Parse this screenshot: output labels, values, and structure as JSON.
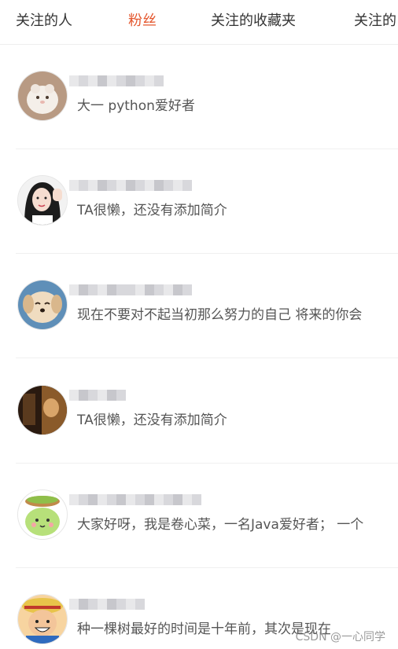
{
  "tabs": [
    {
      "label": "关注的人",
      "active": false
    },
    {
      "label": "粉丝",
      "active": true
    },
    {
      "label": "关注的收藏夹",
      "active": false
    },
    {
      "label": "关注的",
      "active": false
    }
  ],
  "colors": {
    "active_tab": "#e4572e",
    "text": "#333333",
    "bio_text": "#555555",
    "divider": "#f0f0f0"
  },
  "followers": [
    {
      "bio": "大一 python爱好者",
      "avatar_icon": "hamster-avatar"
    },
    {
      "bio": "TA很懒，还没有添加简介",
      "avatar_icon": "girl-waving-avatar"
    },
    {
      "bio": "现在不要对不起当初那么努力的自己 将来的你会",
      "avatar_icon": "puppy-avatar"
    },
    {
      "bio": "TA很懒，还没有添加简介",
      "avatar_icon": "dark-photo-avatar"
    },
    {
      "bio": "大家好呀，我是卷心菜，一名Java爱好者； 一个",
      "avatar_icon": "cabbage-avatar"
    },
    {
      "bio": "种一棵树最好的时间是十年前，其次是现在",
      "avatar_icon": "cartoon-pirate-avatar"
    }
  ],
  "watermark": "CSDN @一心同学"
}
